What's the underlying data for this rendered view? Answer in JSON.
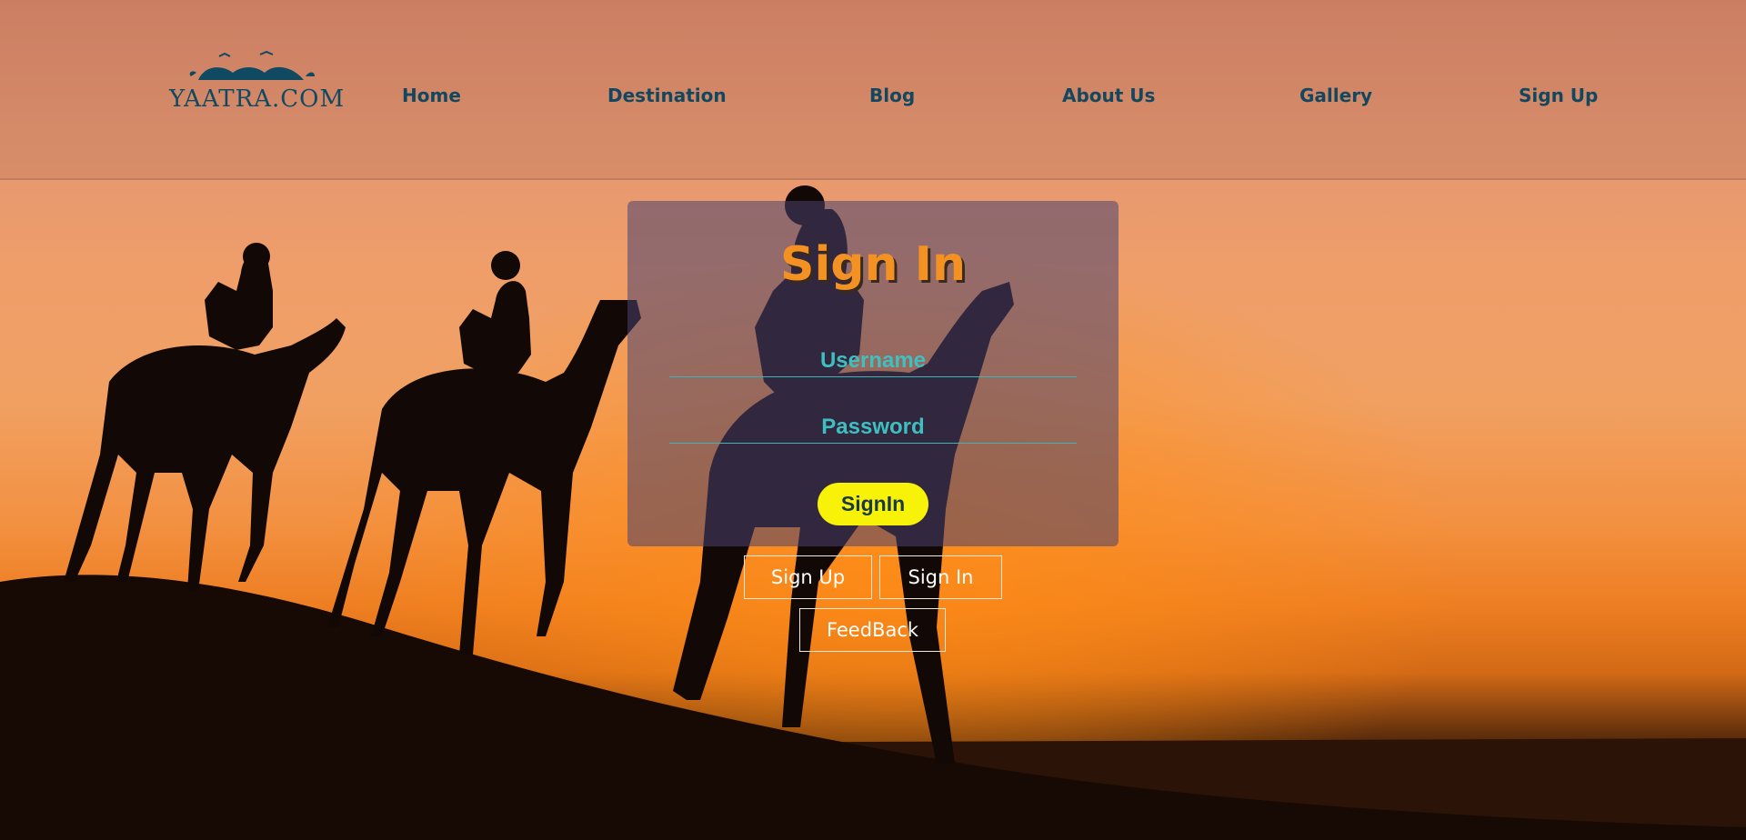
{
  "brand": {
    "logo_text": "YAATRA.COM"
  },
  "nav": {
    "items": [
      {
        "label": "Home"
      },
      {
        "label": "Destination"
      },
      {
        "label": "Blog"
      },
      {
        "label": "About Us"
      },
      {
        "label": "Gallery"
      },
      {
        "label": "Sign Up"
      }
    ]
  },
  "login": {
    "title": "Sign In",
    "username_placeholder": "Username",
    "password_placeholder": "Password",
    "submit_label": "SignIn"
  },
  "links": {
    "signup_label": "Sign Up",
    "signin_label": "Sign In",
    "feedback_label": "FeedBack"
  },
  "colors": {
    "nav_text": "#12485f",
    "title": "#f39223",
    "field_accent": "#3fc0c0",
    "submit_bg": "#f8f208"
  }
}
